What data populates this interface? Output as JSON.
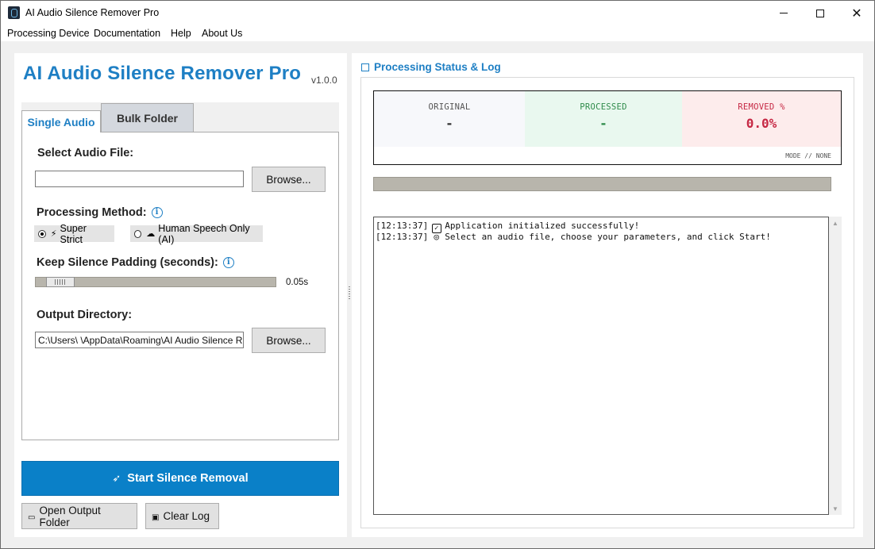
{
  "window": {
    "title": "AI Audio Silence Remover Pro"
  },
  "menu": {
    "items": [
      "Processing Device",
      "Documentation",
      "Help",
      "About Us"
    ]
  },
  "app": {
    "title": "AI Audio Silence Remover Pro",
    "version": "v1.0.0"
  },
  "tabs": {
    "single": "Single Audio",
    "bulk": "Bulk Folder",
    "active": "Single Audio"
  },
  "single": {
    "select_label": "Select Audio File:",
    "file_value": "",
    "browse_label": "Browse...",
    "method_label": "Processing Method:",
    "methods": [
      {
        "label": "Super Strict",
        "selected": true,
        "icon": "lightning-icon"
      },
      {
        "label": "Human Speech Only (AI)",
        "selected": false,
        "icon": "brain-icon"
      }
    ],
    "padding_label": "Keep Silence Padding (seconds):",
    "padding_value": "0.05s",
    "padding_fraction": 0.05,
    "output_label": "Output Directory:",
    "output_value": "C:\\Users\\          \\AppData\\Roaming\\AI Audio Silence Remover Pro",
    "output_browse_label": "Browse..."
  },
  "actions": {
    "start": "Start Silence Removal",
    "open_folder": "Open Output Folder",
    "clear_log": "Clear Log"
  },
  "status": {
    "header": "Processing Status & Log",
    "original_label": "ORIGINAL",
    "original_value": "-",
    "processed_label": "PROCESSED",
    "processed_value": "-",
    "removed_label": "REMOVED %",
    "removed_value": "0.0%",
    "mode": "MODE // NONE",
    "progress": 0
  },
  "log": {
    "lines": [
      {
        "time": "[12:13:37]",
        "icon": "checkbox-icon",
        "text": "Application initialized successfully!"
      },
      {
        "time": "[12:13:37]",
        "icon": "target-icon",
        "text": "Select an audio file, choose your parameters, and click Start!"
      }
    ]
  },
  "colors": {
    "accent": "#1e7fc4",
    "start_button": "#0a80c8",
    "processed_green": "#2e8b4a",
    "removed_red": "#c62844"
  }
}
